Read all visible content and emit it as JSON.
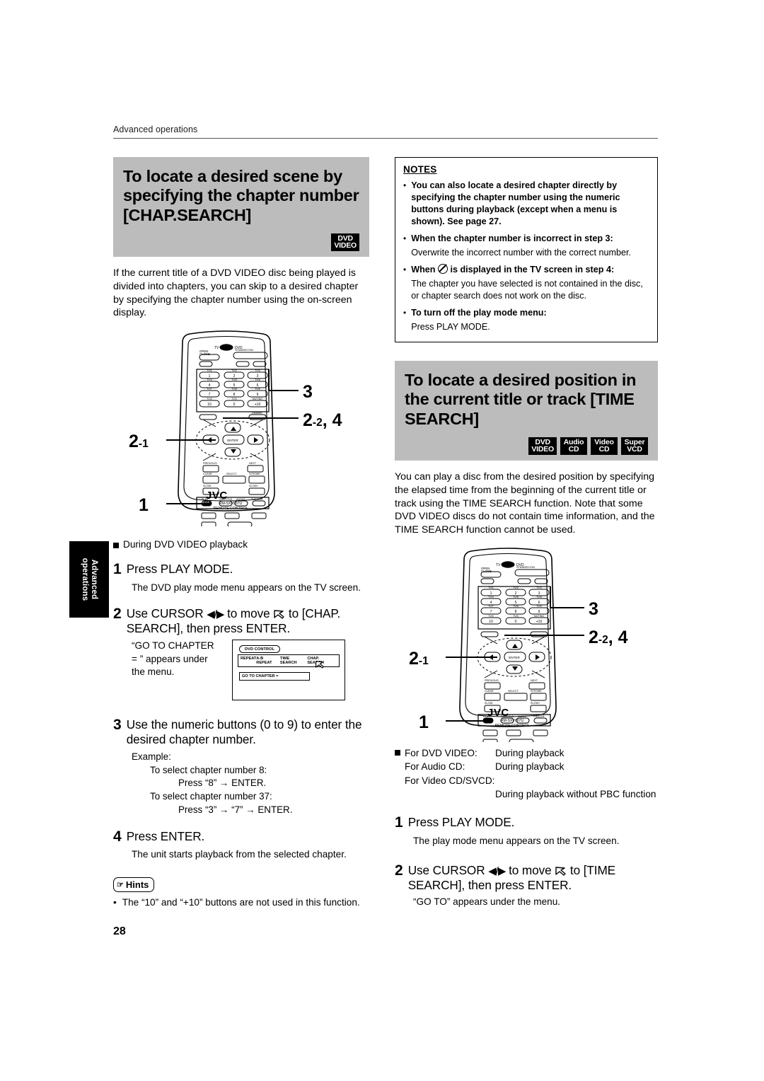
{
  "running_head": "Advanced operations",
  "page_number": "28",
  "side_tab": "Advanced\noperations",
  "left": {
    "heading": "To locate a desired scene by specifying the chapter number [CHAP.SEARCH]",
    "badges": [
      {
        "line1": "DVD",
        "line2": "VIDEO"
      }
    ],
    "intro": "If the current title of a DVD VIDEO disc being played is divided into chapters, you can skip to a desired chapter by specifying the chapter number using the on-screen display.",
    "figure": {
      "callouts": [
        "3",
        "2-2, 4",
        "2-1",
        "1"
      ],
      "brand": "JVC",
      "model": "RM-SXV007U",
      "model_sub": "REMOTE CONTROL"
    },
    "condition": "During DVD VIDEO playback",
    "steps": [
      {
        "num": "1",
        "text": "Press PLAY MODE.",
        "sub": "The DVD play mode menu appears on the TV screen."
      },
      {
        "num": "2",
        "text_a": "Use CURSOR ",
        "text_b": "◀/▶",
        "text_c": " to move ",
        "text_d": " to [CHAP. SEARCH], then press ENTER.",
        "sub": "“GO TO CHAPTER = ” appears under the menu."
      },
      {
        "num": "3",
        "text": "Use the numeric buttons (0 to 9) to enter the desired chapter number.",
        "example_label": "Example:",
        "example_lines": [
          "To select chapter number 8:",
          "Press “8” → ENTER.",
          "To select chapter number 37:",
          "Press “3” → “7” → ENTER."
        ]
      },
      {
        "num": "4",
        "text": "Press ENTER.",
        "sub": "The unit starts playback from the selected chapter."
      }
    ],
    "tv_mock": {
      "title": "DVD CONTROL",
      "menu_items": [
        "REPEAT",
        "A-B REPEAT",
        "TIME SEARCH",
        "CHAP. SEARCH"
      ],
      "field": "GO TO CHAPTER ="
    },
    "hints": {
      "label": "Hints",
      "items": [
        "The “10” and “+10” buttons are not used in this function."
      ]
    }
  },
  "notes": {
    "title": "NOTES",
    "items": [
      {
        "bold": "You can also locate a desired chapter directly by specifying the chapter number using the numeric buttons during playback (except when a menu is shown). See page 27.",
        "normal": ""
      },
      {
        "bold": "When the chapter number is incorrect in step 3:",
        "normal": "Overwrite the incorrect number with the correct number."
      },
      {
        "bold_pre": "When ",
        "bold_post": " is displayed in the TV screen in step 4:",
        "icon": "no-entry-icon",
        "normal": "The chapter you have selected is not contained in the disc, or chapter search does not work on the disc."
      },
      {
        "bold": "To turn off the play mode menu:",
        "normal": "Press PLAY MODE."
      }
    ]
  },
  "right": {
    "heading": "To locate a desired position in the current title or track [TIME SEARCH]",
    "badges": [
      {
        "line1": "DVD",
        "line2": "VIDEO"
      },
      {
        "line1": "Audio",
        "line2": "CD"
      },
      {
        "line1": "Video",
        "line2": "CD"
      },
      {
        "line1": "Super",
        "line2": "VCD"
      }
    ],
    "intro": "You can play a disc from the desired position by specifying the elapsed time from the beginning of the current title or track using the TIME SEARCH function. Note that some DVD VIDEO discs do not contain time information, and the TIME SEARCH function cannot be used.",
    "figure": {
      "callouts": [
        "3",
        "2-2, 4",
        "2-1",
        "1"
      ],
      "brand": "JVC",
      "model": "RM-SXV007U",
      "model_sub": "REMOTE CONTROL"
    },
    "conditions": [
      {
        "key": "For DVD VIDEO:",
        "value": "During playback"
      },
      {
        "key": "For Audio CD:",
        "value": "During playback"
      },
      {
        "key": "For Video CD/SVCD:",
        "value": ""
      },
      {
        "key": "",
        "value": "During playback without PBC function"
      }
    ],
    "steps": [
      {
        "num": "1",
        "text": "Press PLAY MODE.",
        "sub": "The play mode menu appears on the TV screen."
      },
      {
        "num": "2",
        "text_a": "Use CURSOR ",
        "text_b": "◀/▶",
        "text_c": " to move ",
        "text_d": " to [TIME SEARCH],  then press ENTER.",
        "sub": "“GO TO” appears under the menu."
      }
    ]
  }
}
